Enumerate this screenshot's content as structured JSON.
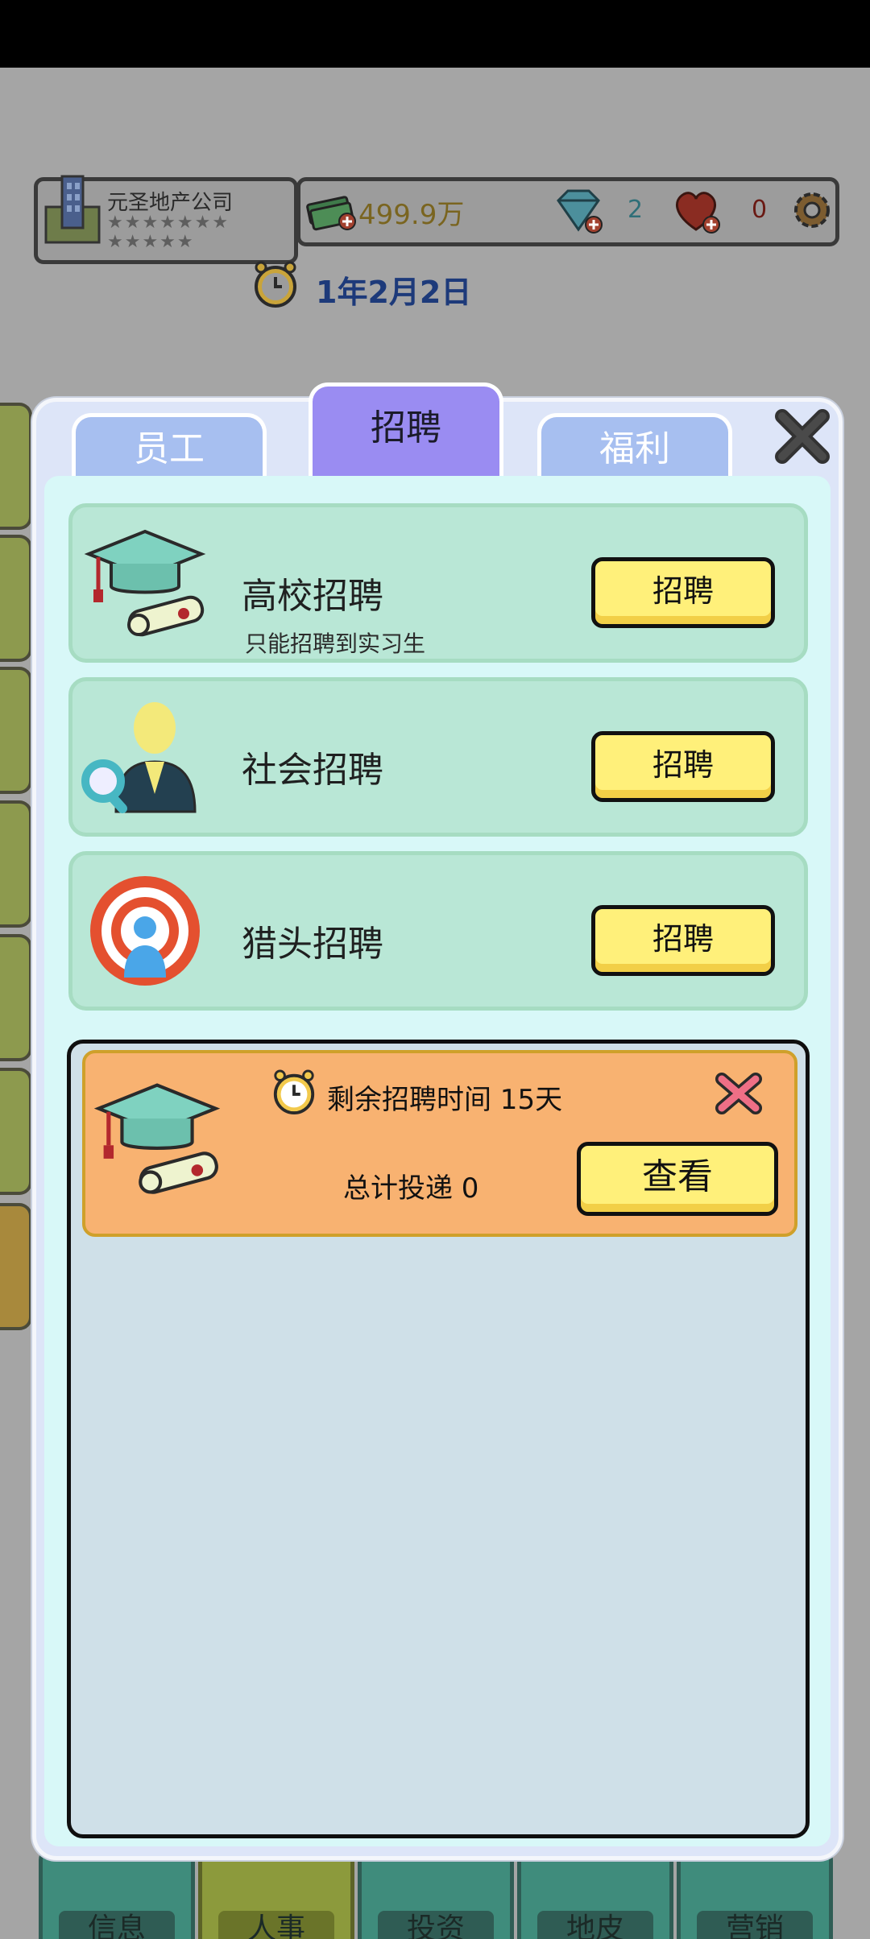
{
  "hud": {
    "company_name": "元圣地产公司",
    "stars_row1": "★★★★★★★",
    "stars_row2": "★★★★★",
    "money": "499.9万",
    "gems": "2",
    "hearts": "0",
    "date": "1年2月2日"
  },
  "tabs": {
    "employees": "员工",
    "recruit": "招聘",
    "welfare": "福利"
  },
  "recruit_options": [
    {
      "title": "高校招聘",
      "subtitle": "只能招聘到实习生",
      "button": "招聘"
    },
    {
      "title": "社会招聘",
      "button": "招聘"
    },
    {
      "title": "猎头招聘",
      "button": "招聘"
    }
  ],
  "active_job": {
    "time_label": "剩余招聘时间 15天",
    "submissions_label": "总计投递 0",
    "view_button": "查看"
  },
  "bottom_nav": [
    {
      "label": "信息"
    },
    {
      "label": "人事"
    },
    {
      "label": "投资"
    },
    {
      "label": "地皮"
    },
    {
      "label": "营销"
    }
  ],
  "colors": {
    "active_tab": "#9a8cf2",
    "inactive_tab": "#a7bff0",
    "card": "#b9e7d6",
    "button": "#fff07a",
    "job_card": "#f8b271"
  }
}
